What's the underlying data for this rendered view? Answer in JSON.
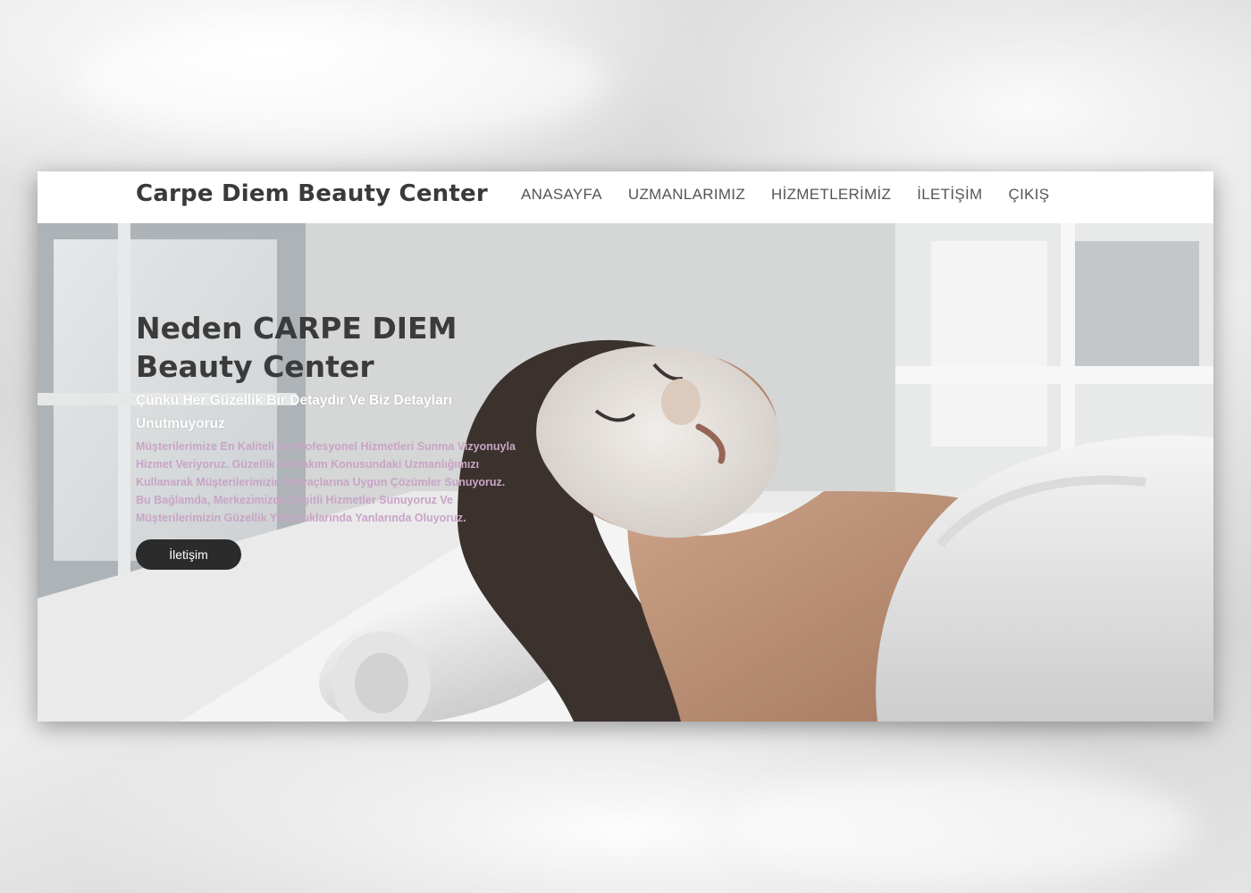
{
  "site": {
    "brand": "Carpe Diem Beauty Center"
  },
  "nav": {
    "items": [
      {
        "label": "ANASAYFA"
      },
      {
        "label": "UZMANLARIMIZ"
      },
      {
        "label": "HİZMETLERİMİZ"
      },
      {
        "label": "İLETİŞİM"
      },
      {
        "label": "ÇIKIŞ"
      }
    ]
  },
  "hero": {
    "title": "Neden CARPE DIEM Beauty Center",
    "subtitle": "Çünkü Her Güzellik Bir Detaydır Ve Biz Detayları Unutmuyoruz",
    "body": "Müşterilerimize En Kaliteli Ve Profesyonel Hizmetleri Sunma Vizyonuyla Hizmet Veriyoruz. Güzellik Ve Bakım Konusundaki Uzmanlığımızı Kullanarak Müşterilerimizin İhtiyaçlarına Uygun Çözümler Sunuyoruz. Bu Bağlamda, Merkezimizde Çeşitli Hizmetler Sunuyoruz Ve Müşterilerimizin Güzellik Yolculuklarında Yanlarında Oluyoruz.",
    "button_label": "İletişim"
  },
  "colors": {
    "title": "#3b3b3b",
    "subtitle": "#ffffff",
    "body": "#c9a4c6",
    "button_bg": "#2b2b2b"
  }
}
